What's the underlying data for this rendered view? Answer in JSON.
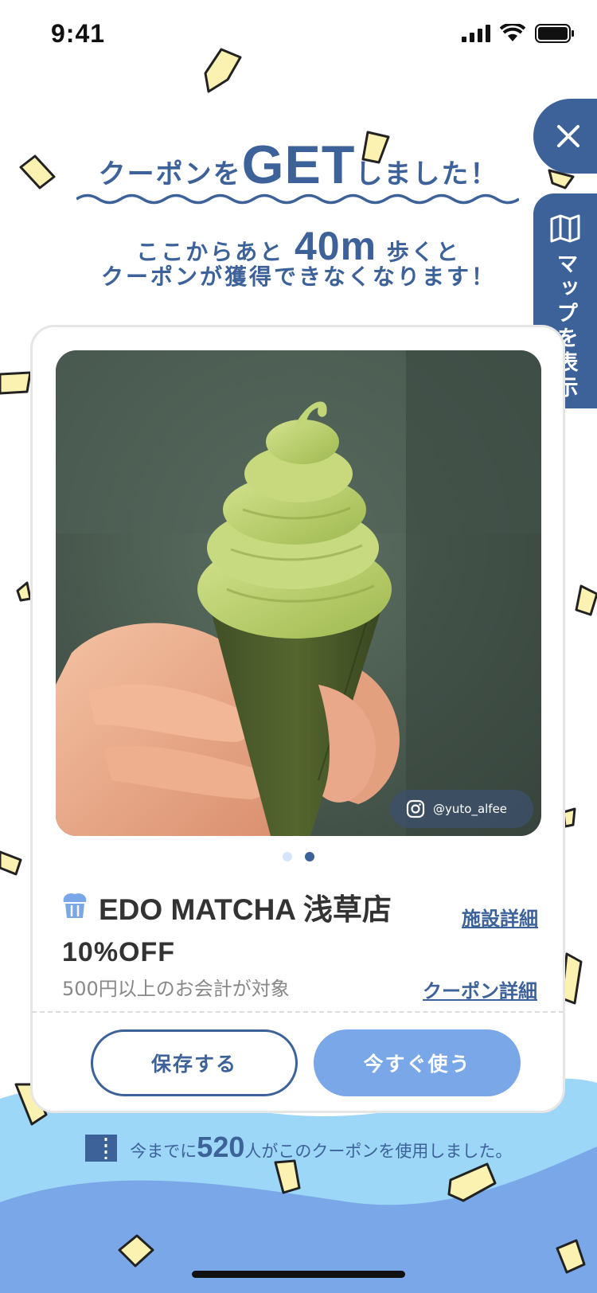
{
  "status_bar": {
    "time": "9:41"
  },
  "headline": {
    "prefix": "クーポンを",
    "emphasis": "GET",
    "suffix": "しました！"
  },
  "subline": {
    "before": "ここからあと",
    "distance": "40m",
    "after": "歩くと",
    "line2": "クーポンが獲得できなくなります！"
  },
  "side_buttons": {
    "map_label": "マップを表示"
  },
  "card": {
    "photo_credit": "@yuto_alfee",
    "carousel": {
      "count": 2,
      "active_index": 1
    },
    "shop_name": "EDO MATCHA 浅草店",
    "facility_link": "施設詳細",
    "discount": "10%OFF",
    "condition": "500円以上のお会計が対象",
    "coupon_link": "クーポン詳細",
    "save_button": "保存する",
    "use_button": "今すぐ使う"
  },
  "usage": {
    "before": "今までに",
    "count": "520",
    "after": "人がこのクーポンを使用しました。"
  },
  "colors": {
    "primary": "#3c6299",
    "accent": "#7aa7e8",
    "wave_light": "#9dd7f7",
    "wave_dark": "#7aa7e8",
    "confetti": "#fbf1b0"
  }
}
